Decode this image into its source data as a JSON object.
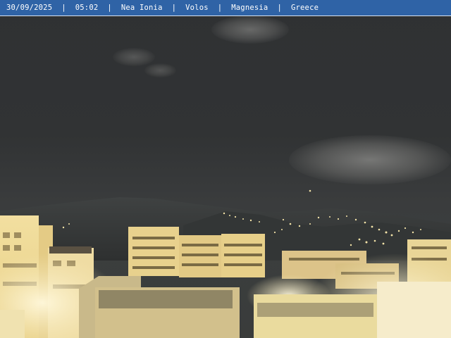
{
  "overlay": {
    "date": "30/09/2025",
    "time": "05:02",
    "district": "Nea Ionia",
    "city": "Volos",
    "region": "Magnesia",
    "country": "Greece",
    "separator": "|"
  },
  "colors": {
    "overlay_background": "#2f63a6",
    "overlay_text": "#ffffff",
    "night_sky": "#313334",
    "city_lights": "#f3e3a8"
  }
}
